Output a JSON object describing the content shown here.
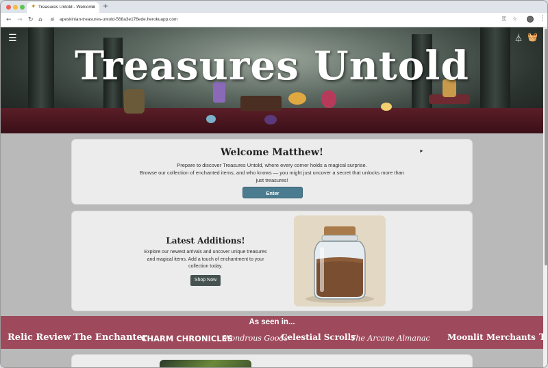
{
  "browser": {
    "tab_title": "Treasures Untold - Welcome",
    "tab_close": "×",
    "new_tab": "+",
    "url": "apeskinian-treasures-untold-568a3e176ede.herokuapp.com"
  },
  "header": {
    "site_title": "Treasures Untold",
    "menu_icon": "hamburger-menu-icon",
    "wand_icon": "wizard-hat-icon",
    "basket_icon": "shopping-basket-icon"
  },
  "welcome": {
    "title": "Welcome Matthew!",
    "line1": "Prepare to discover Treasures Untold, where every corner holds a magical surprise.",
    "line2": "Browse our collection of enchanted items, and who knows — you might just uncover a secret that unlocks more than",
    "line3": "just treasures!",
    "enter_label": "Enter"
  },
  "latest": {
    "title": "Latest Additions!",
    "text": "Explore our newest arrivals and uncover unique treasures and magical items. Add a touch of enchantment to your collection today.",
    "shop_label": "Shop Now"
  },
  "seen_in": {
    "title": "As seen in...",
    "brands": [
      "Relic Review",
      "The Enchanter",
      "CHARM CHRONICLES",
      "Wondrous Goods",
      "Celestial Scrolls",
      "The Arcane Almanac",
      "Moonlit Merchants",
      "T"
    ]
  },
  "colors": {
    "accent_button": "#4a7b8f",
    "shop_button": "#45524f",
    "seen_band": "#9e4a5c"
  }
}
